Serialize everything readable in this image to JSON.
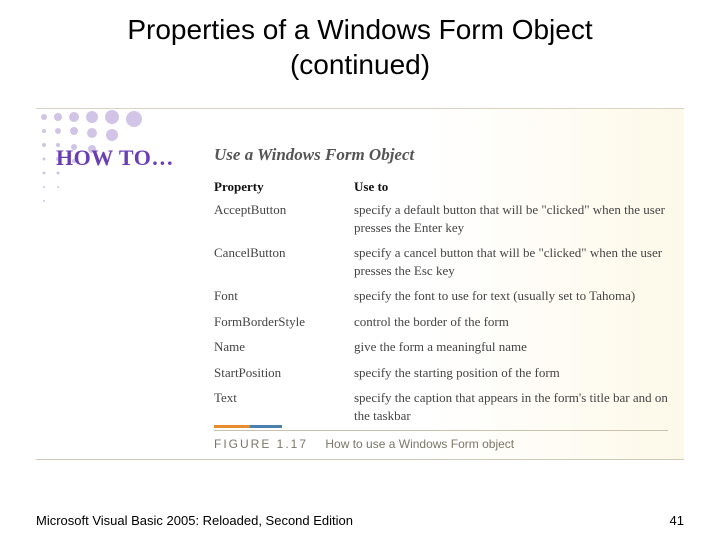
{
  "title_line1": "Properties of a Windows Form Object",
  "title_line2": "(continued)",
  "howto_label": "HOW TO…",
  "subtitle": "Use a Windows Form Object",
  "table": {
    "head_property": "Property",
    "head_use": "Use to",
    "rows": [
      {
        "prop": "AcceptButton",
        "use": "specify a default button that will be \"clicked\" when the user presses the Enter key"
      },
      {
        "prop": "CancelButton",
        "use": "specify a cancel button that will be \"clicked\" when the user presses the Esc key"
      },
      {
        "prop": "Font",
        "use": "specify the font to use for text (usually set to Tahoma)"
      },
      {
        "prop": "FormBorderStyle",
        "use": "control the border of the form"
      },
      {
        "prop": "Name",
        "use": "give the form a meaningful name"
      },
      {
        "prop": "StartPosition",
        "use": "specify the starting position of the form"
      },
      {
        "prop": "Text",
        "use": "specify the caption that appears in the form's title bar and on the taskbar"
      }
    ]
  },
  "figure_label": "FIGURE 1.17",
  "figure_caption": "How to use a Windows Form object",
  "footer_left": "Microsoft Visual Basic 2005: Reloaded, Second Edition",
  "footer_right": "41"
}
